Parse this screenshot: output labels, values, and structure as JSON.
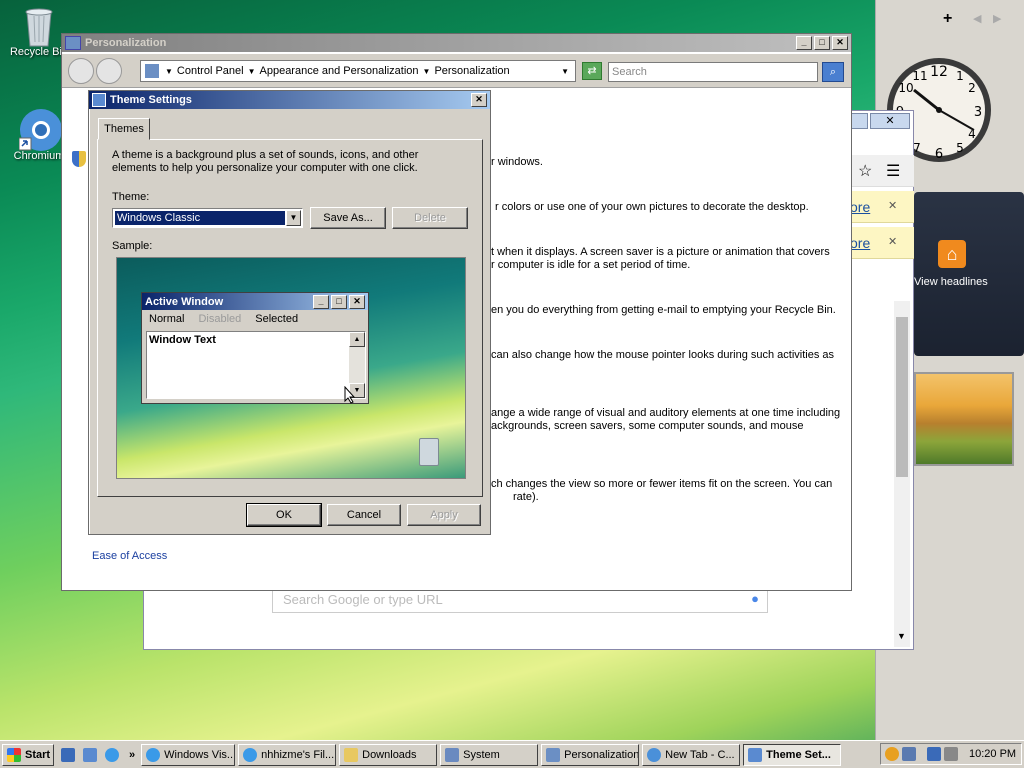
{
  "desktop": {
    "icons": [
      {
        "label": "Recycle Bin"
      },
      {
        "label": "Chromium"
      }
    ]
  },
  "sidebar": {
    "add": "+",
    "feed_label": "View headlines"
  },
  "personalization": {
    "title": "Personalization",
    "breadcrumb": [
      "Control Panel",
      "Appearance and Personalization",
      "Personalization"
    ],
    "search_placeholder": "Search",
    "lines": [
      "r windows.",
      "r colors or use one of your own pictures to decorate the desktop.",
      "t when it displays. A screen saver is a picture or animation that covers",
      "r computer is idle for a set period of time.",
      "en you do everything from getting e-mail to emptying your Recycle Bin.",
      "can also change how the mouse pointer looks during such activities as",
      "ange a wide range of visual and auditory elements at one time including",
      "ackgrounds, screen savers, some computer sounds, and mouse",
      "ch changes the view so more or fewer items fit on the screen. You can",
      "rate)."
    ],
    "ease_of_access": "Ease of Access"
  },
  "browser": {
    "ore1": "ore",
    "ore2": "ore",
    "search_placeholder": "Search Google or type URL"
  },
  "theme_dialog": {
    "title": "Theme Settings",
    "tab": "Themes",
    "description": "A theme is a background plus a set of sounds, icons, and other elements to help you personalize your computer with one click.",
    "theme_label": "Theme:",
    "theme_value": "Windows Classic",
    "save_as": "Save As...",
    "delete": "Delete",
    "sample_label": "Sample:",
    "preview": {
      "title": "Active Window",
      "menu": [
        "Normal",
        "Disabled",
        "Selected"
      ],
      "text": "Window Text"
    },
    "ok": "OK",
    "cancel": "Cancel",
    "apply": "Apply"
  },
  "taskbar": {
    "start": "Start",
    "tasks": [
      "Windows Vis...",
      "nhhizme's Fil...",
      "Downloads",
      "System",
      "Personalization",
      "New Tab - C...",
      "Theme Set..."
    ],
    "clock": "10:20 PM"
  }
}
